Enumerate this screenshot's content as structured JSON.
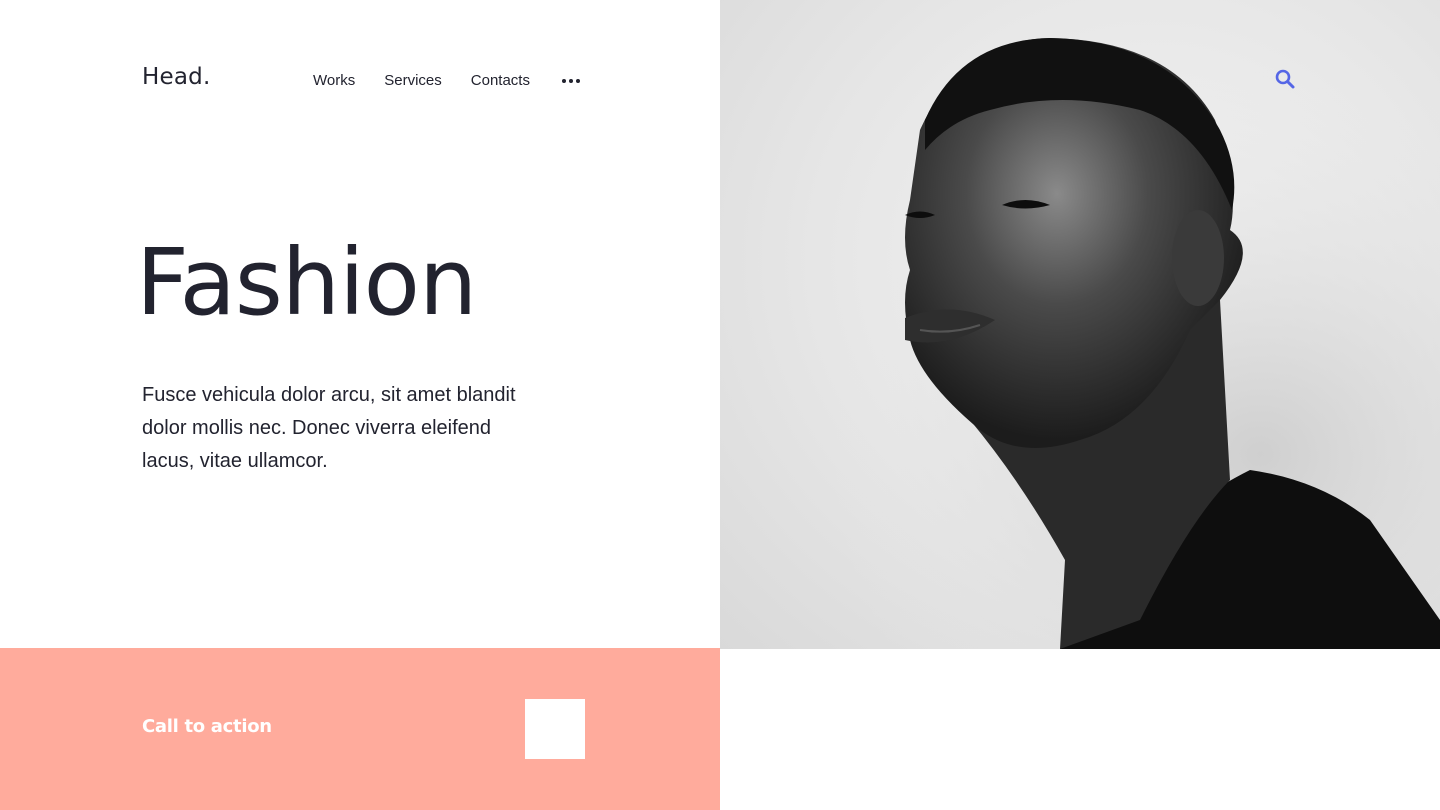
{
  "brand": {
    "logo_text": "Head."
  },
  "nav": {
    "items": [
      {
        "label": "Works"
      },
      {
        "label": "Services"
      },
      {
        "label": "Contacts"
      }
    ],
    "more_icon": "more-dots-icon"
  },
  "hero": {
    "title": "Fashion",
    "description": "Fusce vehicula dolor arcu, sit amet blandit dolor mollis nec. Donec viverra eleifend lacus, vitae ullamcor."
  },
  "photo": {
    "search_icon": "search-icon",
    "style": "black-and-white portrait"
  },
  "cta": {
    "label": "Call to action"
  },
  "colors": {
    "text": "#22232f",
    "accent_salmon": "#ffab9c",
    "search_icon": "#5566e6",
    "background": "#ffffff"
  }
}
